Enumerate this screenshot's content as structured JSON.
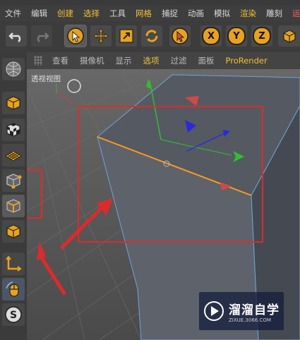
{
  "menu": {
    "items": [
      {
        "label": "文件",
        "color": "normal"
      },
      {
        "label": "编辑",
        "color": "normal"
      },
      {
        "label": "创建",
        "color": "yellow"
      },
      {
        "label": "选择",
        "color": "yellow"
      },
      {
        "label": "工具",
        "color": "normal"
      },
      {
        "label": "网格",
        "color": "yellow"
      },
      {
        "label": "捕捉",
        "color": "normal"
      },
      {
        "label": "动画",
        "color": "normal"
      },
      {
        "label": "模拟",
        "color": "normal"
      },
      {
        "label": "渲染",
        "color": "yellow"
      },
      {
        "label": "雕刻",
        "color": "normal"
      },
      {
        "label": "运动",
        "color": "red"
      }
    ]
  },
  "toolbar": {
    "axis_x": "X",
    "axis_y": "Y",
    "axis_z": "Z"
  },
  "viewport": {
    "menu": [
      "查看",
      "摄像机",
      "显示",
      "选项",
      "过滤",
      "面板",
      "ProRender"
    ],
    "label": "透视视图"
  },
  "watermark": {
    "title": "溜溜自学",
    "url": "ZIXUE.3066.COM"
  },
  "colors": {
    "accent": "#e8a21c",
    "annotation_red": "#e02a2a",
    "edge_highlight": "#ff9a1a"
  }
}
